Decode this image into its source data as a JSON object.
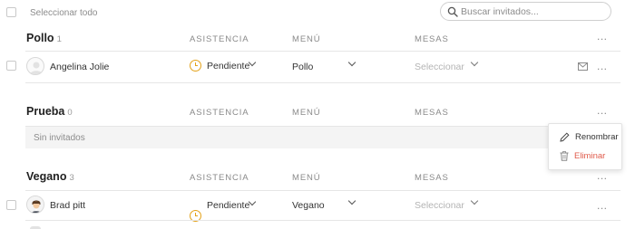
{
  "toolbar": {
    "select_all_label": "Seleccionar todo",
    "search_placeholder": "Buscar invitados..."
  },
  "columns": {
    "attendance": "ASISTENCIA",
    "menu": "MENÚ",
    "tables": "MESAS"
  },
  "groups": [
    {
      "name": "Pollo",
      "count": "1",
      "guests": [
        {
          "name": "Angelina Jolie",
          "attendance": "Pendiente",
          "menu": "Pollo",
          "table": "Seleccionar"
        }
      ]
    },
    {
      "name": "Prueba",
      "count": "0",
      "empty_text": "Sin invitados"
    },
    {
      "name": "Vegano",
      "count": "3",
      "guests": [
        {
          "name": "Brad pitt",
          "attendance": "Pendiente",
          "menu": "Vegano",
          "table": "Seleccionar"
        }
      ]
    }
  ],
  "context_menu": {
    "rename": "Renombrar",
    "delete": "Eliminar"
  },
  "more_symbol": "...",
  "colors": {
    "pending_clock": "#e3a21a",
    "delete_text": "#e05a4a",
    "divider": "#e6e6e6"
  }
}
